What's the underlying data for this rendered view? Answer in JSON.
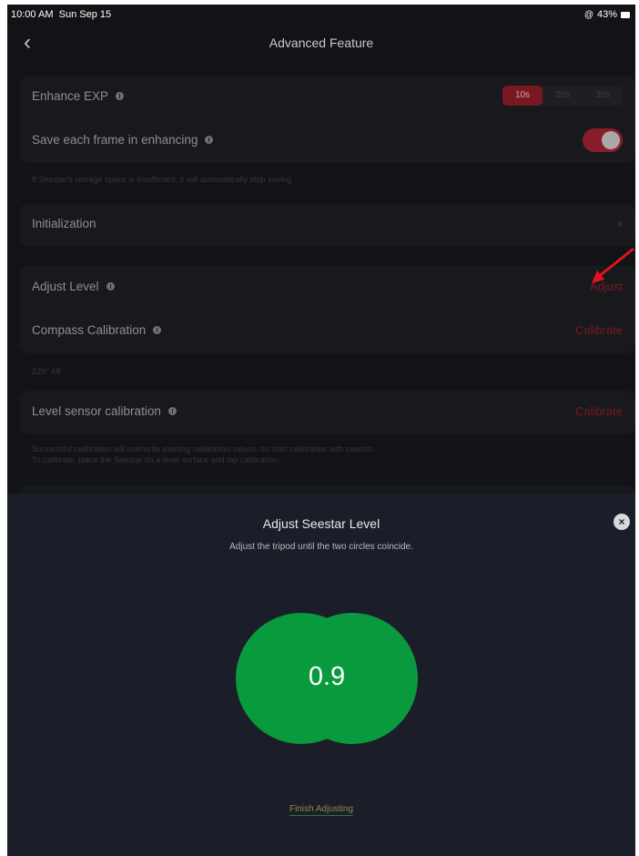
{
  "status_bar": {
    "time": "10:00 AM",
    "date": "Sun Sep 15",
    "battery": "43%"
  },
  "header": {
    "title": "Advanced Feature",
    "back_icon": "chevron-left-icon"
  },
  "settings": {
    "enhance_exp": {
      "label": "Enhance EXP",
      "options": [
        "10s",
        "20s",
        "30s"
      ],
      "selected": "10s"
    },
    "save_frames": {
      "label": "Save each frame in enhancing",
      "enabled": true,
      "note": "If Seestar's storage space is insufficient, it will automatically stop saving"
    },
    "initialization": {
      "label": "Initialization"
    },
    "adjust_level": {
      "label": "Adjust Level",
      "action": "Adjust"
    },
    "compass_calibration": {
      "label": "Compass Calibration",
      "action": "Calibrate",
      "value": "229° 48'"
    },
    "level_sensor": {
      "label": "Level sensor calibration",
      "action": "Calibrate",
      "note_line1": "Successful calibration will overwrite existing calibration values, so start calibration with caution.",
      "note_line2": "To calibrate, place the Seestar on a level surface and tap calibration."
    }
  },
  "sheet": {
    "title": "Adjust Seestar Level",
    "subtitle": "Adjust the tripod until the two circles coincide.",
    "reading": "0.9",
    "finish_label": "Finish Adjusting",
    "close_icon": "close-icon"
  },
  "colors": {
    "accent_red": "#7a1821",
    "level_green": "#0a9a3e",
    "annotation_arrow": "#e0141e"
  }
}
